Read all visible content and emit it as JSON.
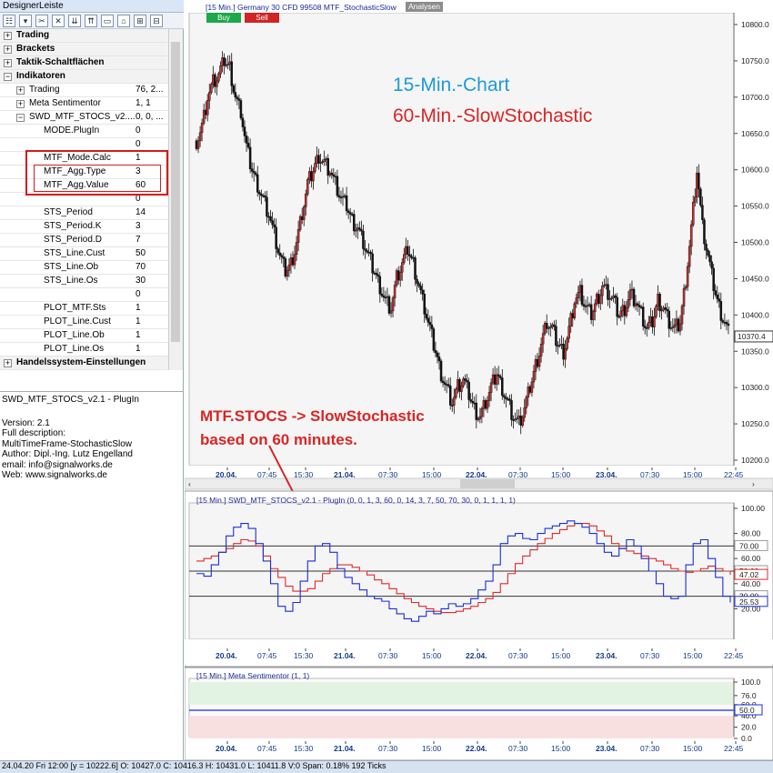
{
  "designer": {
    "title": "DesignerLeiste",
    "pin": "⫯",
    "toolbar": [
      "☷",
      "▾",
      "✂",
      "✕",
      "⇊",
      "⇈",
      "▭",
      "⌂",
      "⊞",
      "⊟"
    ]
  },
  "tree": [
    {
      "label": "Trading",
      "value": "",
      "level": 0,
      "expander": "+",
      "bold": true,
      "section": true
    },
    {
      "label": "Brackets",
      "value": "",
      "level": 0,
      "expander": "+",
      "bold": true,
      "section": true
    },
    {
      "label": "Taktik-Schaltflächen",
      "value": "",
      "level": 0,
      "expander": "+",
      "bold": true,
      "section": true
    },
    {
      "label": "Indikatoren",
      "value": "",
      "level": 0,
      "expander": "−",
      "bold": true,
      "section": true
    },
    {
      "label": "Trading",
      "value": "76, 2...",
      "level": 1,
      "expander": "+",
      "bold": false
    },
    {
      "label": "Meta Sentimentor",
      "value": "1, 1",
      "level": 1,
      "expander": "+",
      "bold": false
    },
    {
      "label": "SWD_MTF_STOCS_v2....",
      "value": "0, 0, ...",
      "level": 1,
      "expander": "−",
      "bold": false
    },
    {
      "label": "MODE.PlugIn",
      "value": "0",
      "level": 2,
      "expander": "",
      "bold": false
    },
    {
      "label": "",
      "value": "0",
      "level": 2,
      "expander": "",
      "bold": false
    },
    {
      "label": "MTF_Mode.Calc",
      "value": "1",
      "level": 2,
      "expander": "",
      "bold": false
    },
    {
      "label": "MTF_Agg.Type",
      "value": "3",
      "level": 2,
      "expander": "",
      "bold": false
    },
    {
      "label": "MTF_Agg.Value",
      "value": "60",
      "level": 2,
      "expander": "",
      "bold": false
    },
    {
      "label": "",
      "value": "0",
      "level": 2,
      "expander": "",
      "bold": false
    },
    {
      "label": "STS_Period",
      "value": "14",
      "level": 2,
      "expander": "",
      "bold": false
    },
    {
      "label": "STS_Period.K",
      "value": "3",
      "level": 2,
      "expander": "",
      "bold": false
    },
    {
      "label": "STS_Period.D",
      "value": "7",
      "level": 2,
      "expander": "",
      "bold": false
    },
    {
      "label": "STS_Line.Cust",
      "value": "50",
      "level": 2,
      "expander": "",
      "bold": false
    },
    {
      "label": "STS_Line.Ob",
      "value": "70",
      "level": 2,
      "expander": "",
      "bold": false
    },
    {
      "label": "STS_Line.Os",
      "value": "30",
      "level": 2,
      "expander": "",
      "bold": false
    },
    {
      "label": "",
      "value": "0",
      "level": 2,
      "expander": "",
      "bold": false
    },
    {
      "label": "PLOT_MTF.Sts",
      "value": "1",
      "level": 2,
      "expander": "",
      "bold": false
    },
    {
      "label": "PLOT_Line.Cust",
      "value": "1",
      "level": 2,
      "expander": "",
      "bold": false
    },
    {
      "label": "PLOT_Line.Ob",
      "value": "1",
      "level": 2,
      "expander": "",
      "bold": false
    },
    {
      "label": "PLOT_Line.Os",
      "value": "1",
      "level": 2,
      "expander": "",
      "bold": false
    },
    {
      "label": "Handelssystem-Einstellungen",
      "value": "",
      "level": 0,
      "expander": "+",
      "bold": true,
      "section": true
    }
  ],
  "info": {
    "title": "SWD_MTF_STOCS_v2.1 - PlugIn",
    "lines": [
      "Version: 2.1",
      "Full description:",
      "MultiTimeFrame-StochasticSlow",
      "Author: Dipl.-Ing. Lutz Engelland",
      "email: info@signalworks.de",
      "Web: www.signalworks.de"
    ]
  },
  "main_chart": {
    "header": "[15 Min.] Germany 30 CFD   99508 MTF_StochasticSlow",
    "analysen": "Analysen",
    "buy": "Buy",
    "sell": "Sell",
    "y_ticks": [
      "10800.0",
      "10750.0",
      "10700.0",
      "10650.0",
      "10600.0",
      "10550.0",
      "10500.0",
      "10450.0",
      "10400.0",
      "10350.0",
      "10300.0",
      "10250.0",
      "10200.0"
    ],
    "last_price": "10370.4",
    "title_blue": "15-Min.-Chart",
    "title_red": "60-Min.-SlowStochastic",
    "annotation_line1": "MTF.STOCS -> SlowStochastic",
    "annotation_line2": "based on 60 minutes.",
    "x_ticks": [
      {
        "label": "20.04.",
        "bold": true
      },
      {
        "label": "07:45",
        "bold": false
      },
      {
        "label": "15:30",
        "bold": false
      },
      {
        "label": "21.04.",
        "bold": true
      },
      {
        "label": "07:30",
        "bold": false
      },
      {
        "label": "15:00",
        "bold": false
      },
      {
        "label": "22.04.",
        "bold": true
      },
      {
        "label": "07:30",
        "bold": false
      },
      {
        "label": "15:00",
        "bold": false
      },
      {
        "label": "23.04.",
        "bold": true
      },
      {
        "label": "07:30",
        "bold": false
      },
      {
        "label": "15:00",
        "bold": false
      },
      {
        "label": "22:45",
        "bold": false
      }
    ],
    "colors": {
      "buy": "#1ea84a",
      "sell": "#d12424",
      "blue_title": "#1d9bd7",
      "red_title": "#d82626",
      "candle_up": "#d92f2f",
      "candle_down": "#111111"
    }
  },
  "stoch_pane": {
    "header": "[15 Min.] SWD_MTF_STOCS_v2.1 - PlugIn  (0, 0, 1, 3, 60, 0, 14, 3, 7, 50, 70, 30, 0, 1, 1, 1, 1)",
    "y_ticks": [
      "100.00",
      "80.00",
      "60.00",
      "40.00",
      "20.00"
    ],
    "level_labels": [
      "70.00",
      "50.00",
      "30.00"
    ],
    "blue_value": "25.53",
    "red_value": "47.02",
    "colors": {
      "blue": "#1a2fd8",
      "red": "#e02a2a"
    }
  },
  "sentiment_pane": {
    "header": "[15 Min.] Meta Sentimentor  (1, 1)",
    "y_ticks": [
      "100.0",
      "76.0",
      "60.0",
      "50.0",
      "40.0",
      "20.0",
      "0.0"
    ],
    "value_label": "50.0"
  },
  "status": {
    "text": "24.04.20 Fri  12:00 [y = 10222.6]    O: 10427.0 C: 10416.3 H: 10431.0 L: 10411.8 V:0 Span: 0.18% 192 Ticks"
  },
  "chart_data": [
    {
      "type": "line",
      "title": "15-Min.-Chart",
      "series": [
        {
          "name": "Germany 30 CFD",
          "values": [
            10640,
            10660,
            10700,
            10720,
            10730,
            10750,
            10740,
            10700,
            10680,
            10630,
            10600,
            10580,
            10560,
            10540,
            10510,
            10480,
            10460,
            10470,
            10500,
            10540,
            10580,
            10600,
            10620,
            10610,
            10600,
            10580,
            10560,
            10550,
            10530,
            10520,
            10500,
            10480,
            10460,
            10440,
            10420,
            10410,
            10450,
            10470,
            10490,
            10470,
            10440,
            10410,
            10380,
            10350,
            10320,
            10300,
            10280,
            10300,
            10310,
            10290,
            10270,
            10260,
            10280,
            10300,
            10320,
            10300,
            10280,
            10260,
            10250,
            10270,
            10300,
            10330,
            10360,
            10390,
            10380,
            10360,
            10350,
            10380,
            10420,
            10430,
            10410,
            10400,
            10420,
            10440,
            10430,
            10420,
            10400,
            10410,
            10430,
            10420,
            10400,
            10380,
            10390,
            10420,
            10410,
            10390,
            10380,
            10390,
            10450,
            10520,
            10600,
            10520,
            10480,
            10440,
            10410,
            10390,
            10370
          ]
        }
      ],
      "ylim": [
        10200,
        10800
      ],
      "last": 10370.4
    },
    {
      "type": "line",
      "series": [
        {
          "values": [
            48,
            46,
            55,
            65,
            78,
            85,
            88,
            84,
            72,
            58,
            40,
            22,
            18,
            25,
            42,
            58,
            70,
            72,
            65,
            52,
            45,
            40,
            35,
            30,
            28,
            26,
            20,
            16,
            12,
            10,
            14,
            18,
            16,
            20,
            24,
            22,
            24,
            28,
            35,
            42,
            55,
            72,
            78,
            80,
            76,
            75,
            80,
            84,
            86,
            88,
            90,
            88,
            85,
            80,
            72,
            65,
            62,
            68,
            75,
            70,
            60,
            50,
            40,
            30,
            28,
            30,
            55,
            72,
            75,
            60,
            45,
            30,
            25
          ]
        },
        {
          "values": [
            58,
            60,
            62,
            65,
            68,
            72,
            75,
            74,
            70,
            62,
            52,
            45,
            38,
            34,
            34,
            36,
            42,
            48,
            52,
            55,
            55,
            53,
            50,
            47,
            43,
            40,
            36,
            32,
            28,
            25,
            22,
            20,
            18,
            17,
            17,
            18,
            20,
            22,
            25,
            28,
            33,
            40,
            48,
            56,
            62,
            67,
            72,
            76,
            80,
            83,
            86,
            88,
            88,
            86,
            82,
            78,
            72,
            68,
            66,
            64,
            62,
            60,
            58,
            55,
            52,
            50,
            49,
            50,
            52,
            54,
            52,
            50,
            47
          ]
        }
      ],
      "ylim": [
        0,
        100
      ],
      "levels": [
        70,
        50,
        30
      ]
    },
    {
      "type": "line",
      "series": [
        {
          "values": [
            50,
            50,
            50,
            50,
            50,
            50,
            50,
            50,
            50,
            50
          ]
        }
      ],
      "ylim": [
        0,
        100
      ],
      "bands": [
        [
          60,
          76
        ],
        [
          20,
          40
        ]
      ]
    }
  ]
}
